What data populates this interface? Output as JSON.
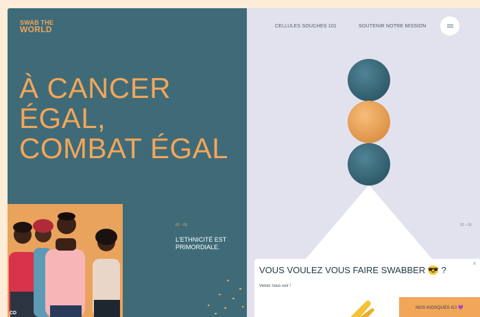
{
  "brand": {
    "line1": "SWAB THE",
    "line2": "WORLD"
  },
  "nav": {
    "item1": "CELLULES SOUCHES 101",
    "item2": "SOUTENIR NOTRE MISSION"
  },
  "icons": {
    "menu": "hamburger-menu-icon",
    "close": "close-icon",
    "emoji": "sunglasses-emoji-icon",
    "heart": "purple-heart-icon"
  },
  "hero": {
    "line1": "À CANCER",
    "line2": "ÉGAL,",
    "line3": "COMBAT ÉGAL"
  },
  "slide": {
    "counter_left": "02 – 03",
    "counter_right": "02 – 03",
    "text_line1": "L'ETHNICITÉ EST",
    "text_line2": "PRIMORDIALE."
  },
  "photo": {
    "badge": "CD"
  },
  "popup": {
    "title": "VOUS VOULEZ VOUS FAIRE SWABBER 😎 ?",
    "subtitle": "Venez nous voir !",
    "button": "NOS KIOSQUES ICI 💜",
    "close": "×"
  },
  "colors": {
    "teal": "#3f6b78",
    "orange": "#f2a65a",
    "lavender": "#e1e2ee",
    "peach": "#fdecd8"
  }
}
